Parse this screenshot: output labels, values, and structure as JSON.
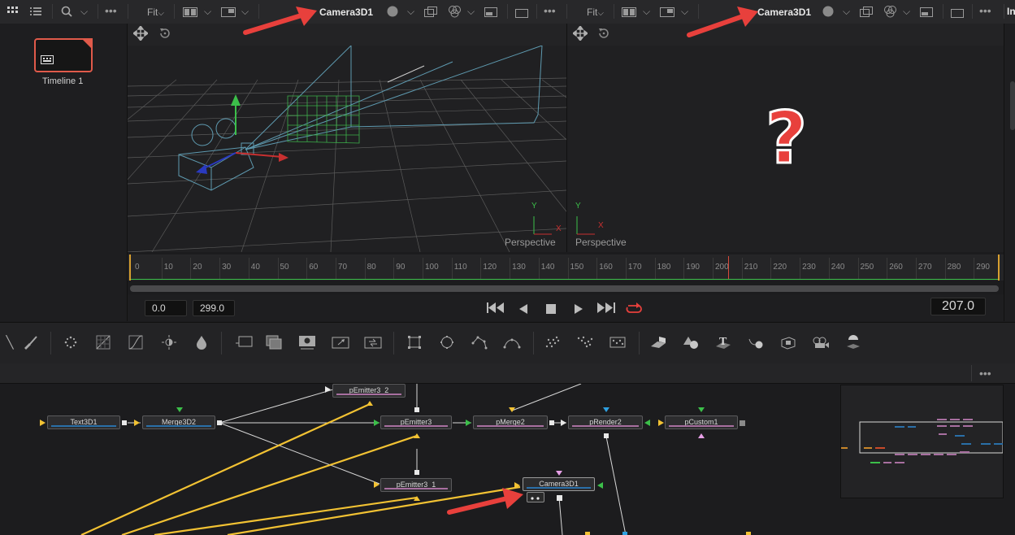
{
  "media_pool": {
    "clip_label": "Timeline 1"
  },
  "viewer_left": {
    "fit_label": "Fit",
    "title": "Camera3D1",
    "view_label": "Perspective",
    "axis_y": "Y",
    "axis_x": "X"
  },
  "viewer_right": {
    "fit_label": "Fit",
    "title": "Camera3D1",
    "view_label": "Perspective",
    "axis_y": "Y",
    "axis_x": "X",
    "annotation": "?"
  },
  "inspector_tab": "In",
  "ruler": {
    "ticks": [
      "0",
      "10",
      "20",
      "30",
      "40",
      "50",
      "60",
      "70",
      "80",
      "90",
      "100",
      "110",
      "120",
      "130",
      "140",
      "150",
      "160",
      "170",
      "180",
      "190",
      "200",
      "210",
      "220",
      "230",
      "240",
      "250",
      "260",
      "270",
      "280",
      "290"
    ]
  },
  "transport": {
    "start": "0.0",
    "end": "299.0",
    "current_frame": "207.0"
  },
  "nodes": {
    "text3d": "Text3D1",
    "merge3d": "Merge3D2",
    "pemitter3_2": "pEmitter3_2",
    "pemitter3": "pEmitter3",
    "pmerge2": "pMerge2",
    "prender2": "pRender2",
    "pcustom1": "pCustom1",
    "pemitter3_1": "pEmitter3_1",
    "camera3d": "Camera3D1"
  },
  "colors": {
    "accent_red": "#e8403c",
    "playhead": "#d84a3a",
    "node_blue": "#2a6fa8",
    "yellow_link": "#f2c233",
    "green_axis": "#3cbf4a"
  }
}
